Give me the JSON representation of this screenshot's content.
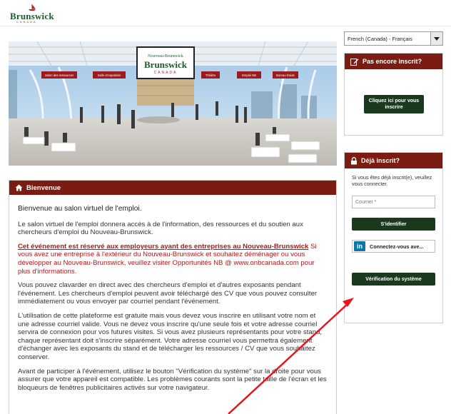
{
  "header": {
    "logo_text": "Brunswick",
    "logo_sub": "CANADA"
  },
  "hero": {
    "sign_text": "Nouveau-Brunswick",
    "sign_sub": "CANADA",
    "booths": [
      "Salon des ressources",
      "Salle d'exposition",
      "Théâtre",
      "Emploi NB",
      "Bureau d'aide"
    ]
  },
  "language": {
    "selected": "French (Canada) - Français"
  },
  "welcome": {
    "header": "Bienvenue",
    "title": "Bienvenue au salon virtuel de l'emploi.",
    "p1": "Le salon virtuel de l'emploi donnera accès à de l'information, des ressources et du soutien aux chercheurs d'emploi du Nouveau-Brunswick.",
    "p2_link": "Cet événement est réservé aux employeurs ayant des entreprises au Nouveau-Brunswick",
    "p2_rest": "Si vous avez une entreprise à l'extérieur du Nouveau-Brunswick et souhaitez déménager ou vous développer au Nouveau-Brunswick, veuillez visiter Opportunités NB @ www.onbcanada.com pour plus d'informations.",
    "p3": "Vous pouvez clavarder en direct avec des chercheurs d'emploi et d'autres exposants pendant l'événement. Les chercheurs d'emploi peuvent avoir téléchargé des CV que vous pouvez consulter immédiatement ou vous envoyer par courriel pendant l'événement.",
    "p4": "L'utilisation de cette plateforme est gratuite mais vous devez vous inscrire en utilisant votre nom et une adresse courriel valide. Vous ne devez vous inscrire qu'une seule fois et votre adresse courriel servira de connexion pour vos futures visites. Si vous avez plusieurs représentants pour votre stand, chaque représentant doit s'inscrire séparément. Votre adresse courriel vous permettra également d'échanger avec les exposants du stand et de télécharger les ressources / CV que vous souhaitez conserver.",
    "p5": "Avant de participer à l'événement, utilisez le bouton \"Vérification du système\" sur la droite pour vous assurer que votre appareil est compatible. Les problèmes courants sont la petite taille de l'écran et les bloqueurs de fenêtres publicitaires activés sur votre navigateur."
  },
  "signup": {
    "header": "Pas encore inscrit?",
    "button": "Cliquez ici pour vous inscrire"
  },
  "login": {
    "header": "Déjà inscrit?",
    "text": "Si vous êtes déjà inscrit(e), veuillez vous connecter.",
    "email_placeholder": "Courriel *",
    "signin_button": "S'identifier",
    "linkedin_icon": "in",
    "linkedin_button": "Connectez-vous ave...",
    "syscheck_button": "Vérification du système"
  },
  "colors": {
    "panel_header": "#7b1c12",
    "dark_button": "#1b3a1d",
    "link_red": "#b1181c",
    "linkedin": "#0e76a8",
    "arrow": "#e8141c"
  },
  "icons": {
    "welcome": "home-icon",
    "signup": "edit-icon",
    "login": "lock-icon",
    "language": "caret-down-icon"
  }
}
